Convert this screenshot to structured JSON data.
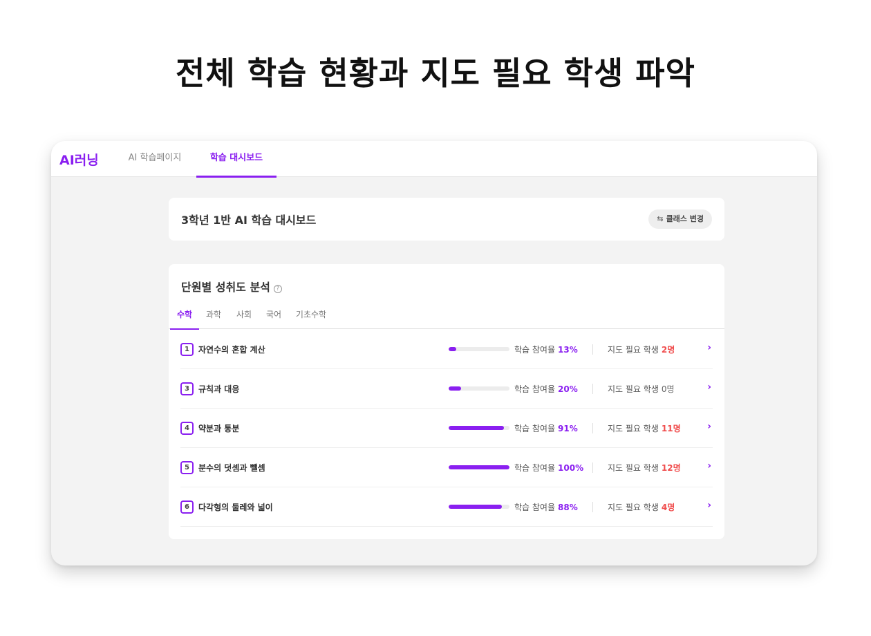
{
  "headline": "전체 학습 현황과 지도 필요 학생 파악",
  "nav": {
    "logo": "AI러닝",
    "tabs": [
      {
        "label": "AI 학습페이지"
      },
      {
        "label": "학습 대시보드"
      }
    ],
    "active_tab": "학습 대시보드"
  },
  "class_card": {
    "title": "3학년 1반 AI 학습 대시보드",
    "change_button": "클래스 변경",
    "change_icon": "swap-arrows-icon"
  },
  "analysis": {
    "title": "단원별 성취도 분석",
    "help_icon": "question-circle-icon",
    "subjects": [
      "수학",
      "과학",
      "사회",
      "국어",
      "기초수학"
    ],
    "active_subject": "수학",
    "participation_label": "학습 참여율",
    "need_label": "지도 필요 학생",
    "units": [
      {
        "num": "1",
        "name": "자연수의 혼합 계산",
        "participation": 13,
        "participation_text": "13%",
        "need_text": "2명"
      },
      {
        "num": "3",
        "name": "규칙과 대응",
        "participation": 20,
        "participation_text": "20%",
        "need_text": "0명"
      },
      {
        "num": "4",
        "name": "약분과 통분",
        "participation": 91,
        "participation_text": "91%",
        "need_text": "11명"
      },
      {
        "num": "5",
        "name": "분수의 덧셈과 뺄셈",
        "participation": 100,
        "participation_text": "100%",
        "need_text": "12명"
      },
      {
        "num": "6",
        "name": "다각형의 둘레와 넓이",
        "participation": 88,
        "participation_text": "88%",
        "need_text": "4명"
      }
    ]
  },
  "colors": {
    "accent": "#8a1ff0",
    "alert": "#f04e4e"
  }
}
